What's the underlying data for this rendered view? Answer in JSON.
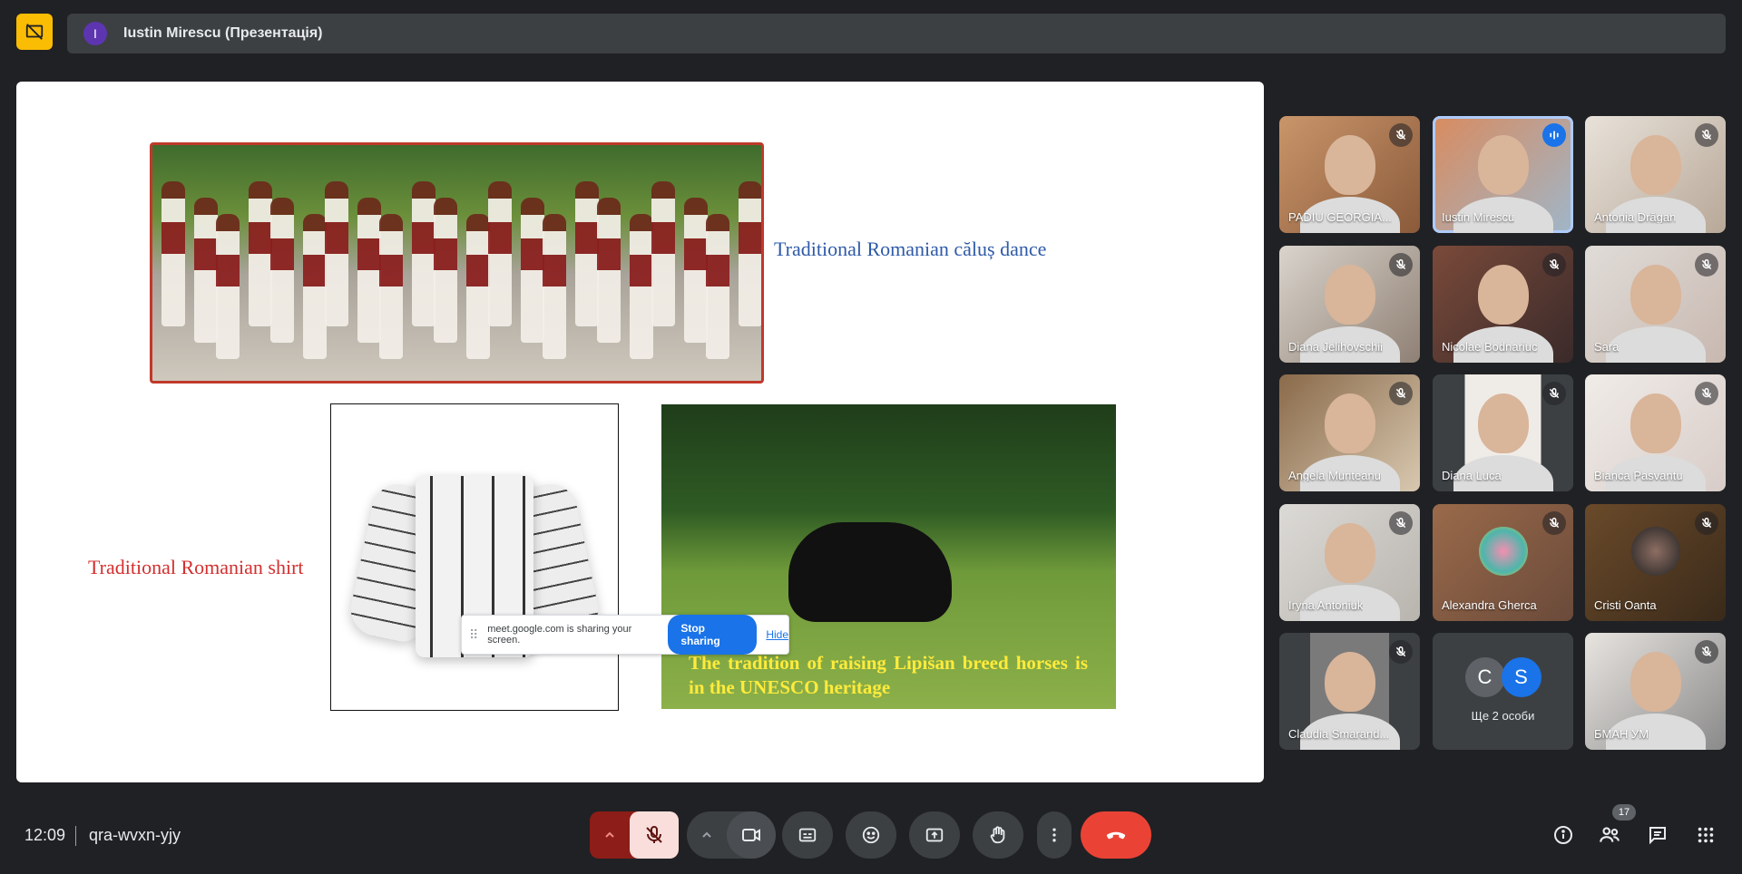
{
  "presenter": {
    "initial": "I",
    "name": "Iustin Mirescu (Презентація)"
  },
  "slide": {
    "dance_caption": "Traditional Romanian căluș dance",
    "shirt_caption": "Traditional Romanian shirt",
    "horse_caption": "The tradition of raising Lipišan breed horses is in the UNESCO heritage"
  },
  "share_bar": {
    "text": "meet.google.com is sharing your screen.",
    "stop_label": "Stop sharing",
    "hide_label": "Hide"
  },
  "participants": [
    {
      "name": "PADIU GEORGIA...",
      "mic": "muted"
    },
    {
      "name": "Iustin Mirescu",
      "mic": "speaking"
    },
    {
      "name": "Antonia Drăgan",
      "mic": "muted"
    },
    {
      "name": "Diana Jelihovschii",
      "mic": "muted"
    },
    {
      "name": "Nicolae Bodnariuc",
      "mic": "muted"
    },
    {
      "name": "Sara",
      "mic": "muted"
    },
    {
      "name": "Angela Munteanu",
      "mic": "muted"
    },
    {
      "name": "Diana Luca",
      "mic": "muted"
    },
    {
      "name": "Bianca Pasvantu",
      "mic": "muted"
    },
    {
      "name": "Iryna Antoniuk",
      "mic": "muted"
    },
    {
      "name": "Alexandra Gherca",
      "mic": "muted"
    },
    {
      "name": "Cristi Oanta",
      "mic": "muted"
    },
    {
      "name": "Claudia Smarand...",
      "mic": "muted"
    },
    {
      "name": "БМАН УМ",
      "mic": "muted"
    }
  ],
  "more_tile": {
    "label": "Ще 2 особи",
    "initials": [
      "C",
      "S"
    ],
    "colors": [
      "#5f6368",
      "#1a73e8"
    ]
  },
  "meeting": {
    "time": "12:09",
    "code": "qra-wvxn-yjy"
  },
  "people_count": "17",
  "colors": {
    "accent": "#1a73e8",
    "end_call": "#ea4335",
    "present": "#fbbc04"
  }
}
